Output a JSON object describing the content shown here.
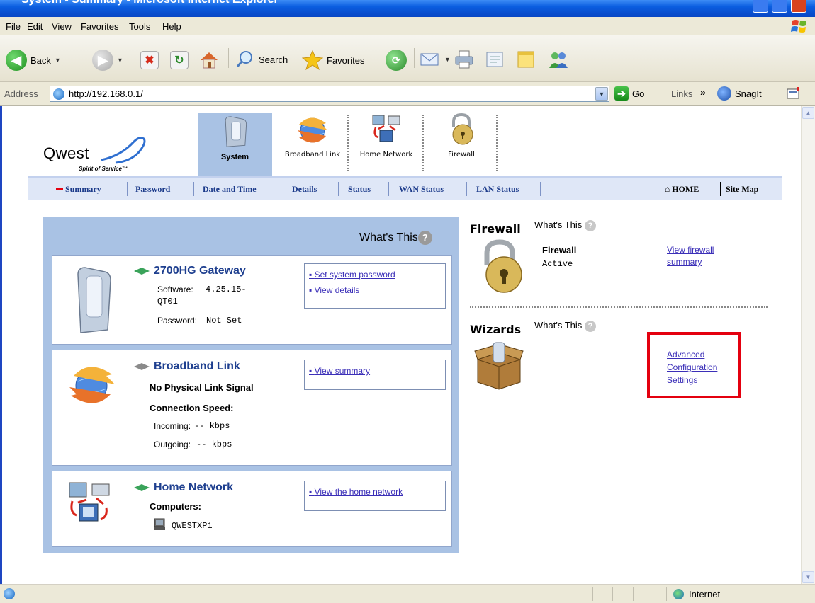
{
  "window": {
    "title": "System - Summary - Microsoft Internet Explorer"
  },
  "menu": [
    "File",
    "Edit",
    "View",
    "Favorites",
    "Tools",
    "Help"
  ],
  "toolbar": {
    "back": "Back",
    "search": "Search",
    "favorites": "Favorites"
  },
  "address": {
    "label": "Address",
    "url": "http://192.168.0.1/",
    "go": "Go",
    "links": "Links",
    "chevrons": "»",
    "snagit": "SnagIt"
  },
  "brand": {
    "name": "Qwest",
    "tagline": "Spirit of Service™"
  },
  "nav_tabs": [
    "System",
    "Broadband Link",
    "Home Network",
    "Firewall"
  ],
  "subnav": [
    "Summary",
    "Password",
    "Date and Time",
    "Details",
    "Status",
    "WAN Status",
    "LAN Status"
  ],
  "home_link": "HOME",
  "sitemap_link": "Site Map",
  "whats_this": "What's This",
  "gateway": {
    "title": "2700HG Gateway",
    "software_label": "Software:",
    "software_value": "4.25.15-QT01",
    "password_label": "Password:",
    "password_value": "Not Set",
    "links": [
      "Set system password",
      "View details"
    ]
  },
  "broadband": {
    "title": "Broadband Link",
    "signal": "No Physical Link Signal",
    "speed_label": "Connection Speed:",
    "incoming_label": "Incoming:",
    "outgoing_label": "Outgoing:",
    "incoming": "-- kbps",
    "outgoing": "-- kbps",
    "links": [
      "View summary"
    ]
  },
  "home_network": {
    "title": "Home Network",
    "computers_label": "Computers:",
    "computer": "QWESTXP1",
    "links": [
      "View the home network"
    ]
  },
  "firewall_section": {
    "title": "Firewall",
    "name": "Firewall",
    "status": "Active",
    "link": "View firewall summary"
  },
  "wizards_section": {
    "title": "Wizards",
    "link": "Advanced Configuration Settings"
  },
  "status": {
    "zone": "Internet"
  },
  "colors": {
    "highlight": "#e4000f",
    "link": "#3b2fb8",
    "nav": "#1b3a8a"
  }
}
